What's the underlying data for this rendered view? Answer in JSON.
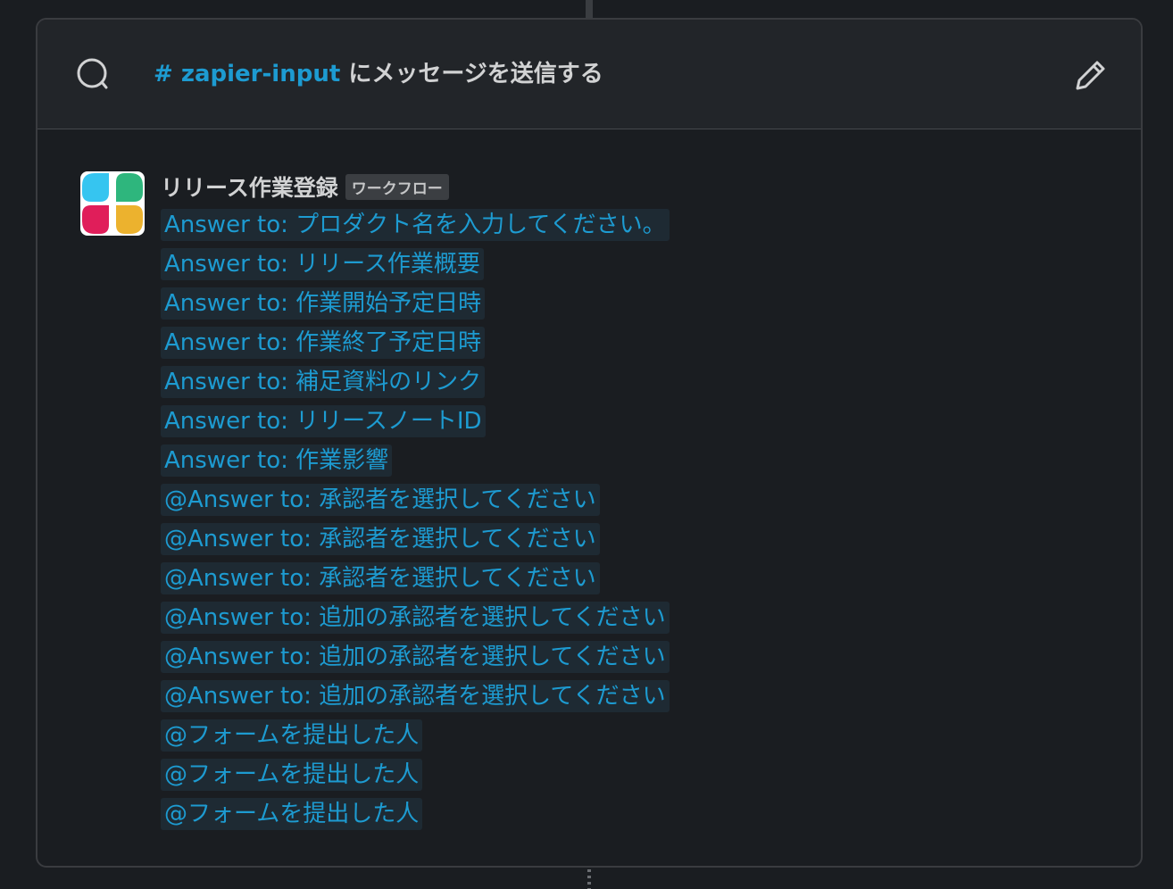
{
  "header": {
    "channel": "# zapier-input",
    "suffix": " にメッセージを送信する",
    "search_icon": "search-icon",
    "edit_icon": "pencil-icon"
  },
  "message": {
    "sender": "リリース作業登録",
    "badge": "ワークフロー",
    "avatar_colors": [
      "#36c5f0",
      "#2eb67d",
      "#e01e5a",
      "#ecb22e"
    ],
    "lines": [
      "Answer to: プロダクト名を入力してください。",
      "Answer to: リリース作業概要",
      "Answer to: 作業開始予定日時",
      "Answer to: 作業終了予定日時",
      "Answer to: 補足資料のリンク",
      "Answer to: リリースノートID",
      "Answer to: 作業影響",
      "@Answer to: 承認者を選択してください",
      "@Answer to: 承認者を選択してください",
      "@Answer to: 承認者を選択してください",
      "@Answer to: 追加の承認者を選択してください",
      "@Answer to: 追加の承認者を選択してください",
      "@Answer to: 追加の承認者を選択してください",
      "@フォームを提出した人",
      "@フォームを提出した人",
      "@フォームを提出した人"
    ]
  },
  "colors": {
    "accent": "#1d9bd1",
    "background": "#1a1d21",
    "header_bg": "#222529",
    "chip_bg": "#1e2a33"
  }
}
